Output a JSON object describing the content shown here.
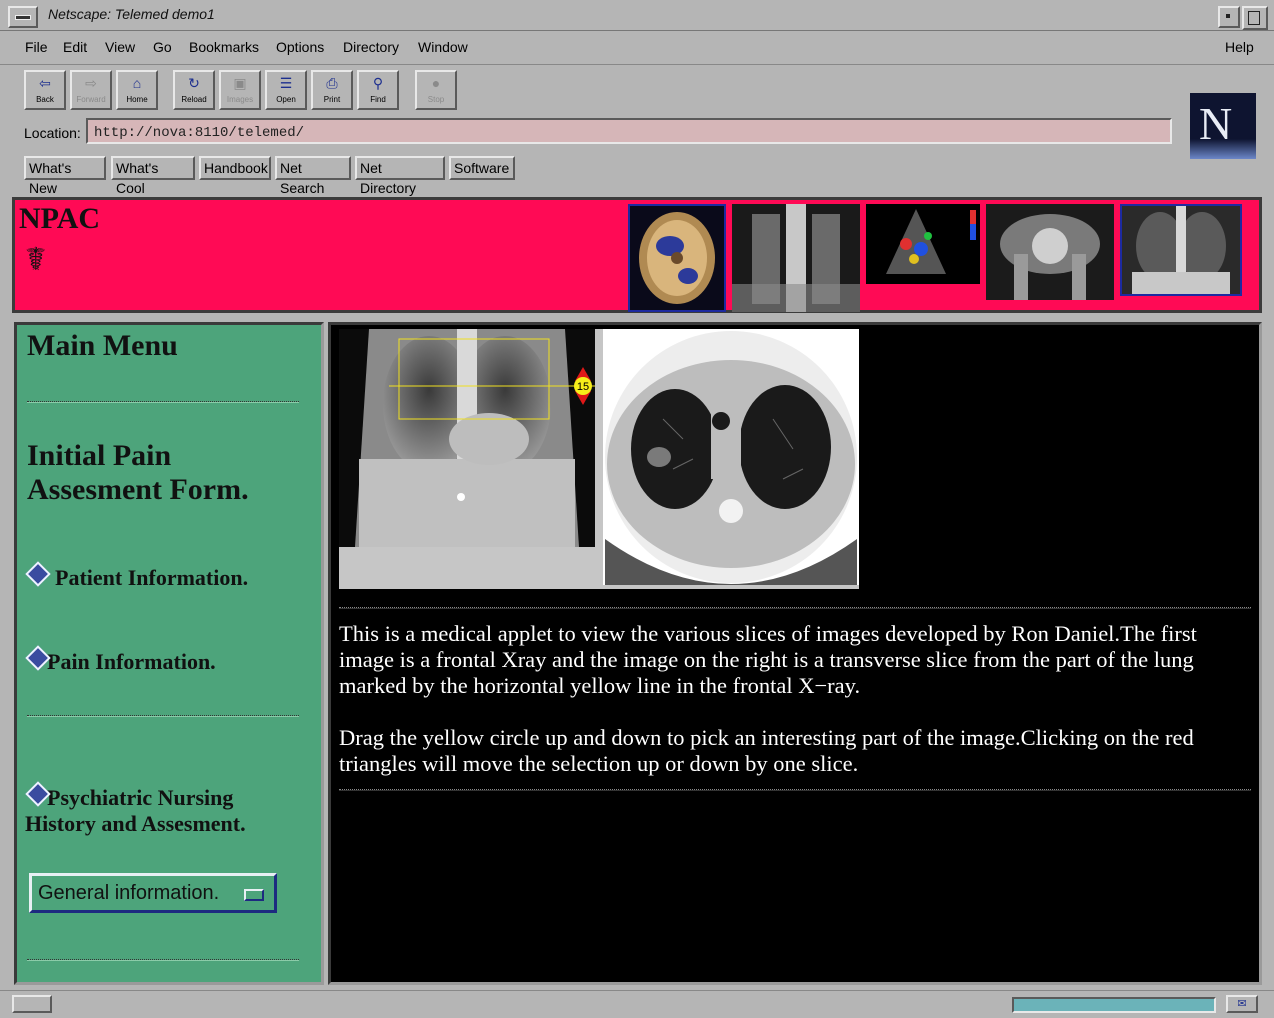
{
  "window": {
    "title": "Netscape: Telemed demo1"
  },
  "menu": {
    "file": "File",
    "edit": "Edit",
    "view": "View",
    "go": "Go",
    "bookmarks": "Bookmarks",
    "options": "Options",
    "directory": "Directory",
    "window": "Window",
    "help": "Help"
  },
  "toolbar": {
    "back": "Back",
    "forward": "Forward",
    "home": "Home",
    "reload": "Reload",
    "images": "Images",
    "open": "Open",
    "print": "Print",
    "find": "Find",
    "stop": "Stop"
  },
  "location": {
    "label": "Location:",
    "url": "http://nova:8110/telemed/"
  },
  "directory_buttons": {
    "whats_new": "What's New",
    "whats_cool": "What's Cool",
    "handbook": "Handbook",
    "net_search": "Net Search",
    "net_directory": "Net Directory",
    "software": "Software"
  },
  "logo": {
    "letter": "N"
  },
  "banner": {
    "title": "NPAC",
    "emblem": "☤"
  },
  "left_menu": {
    "heading": "Main Menu",
    "form_title_line1": "Initial Pain",
    "form_title_line2": "Assesment Form.",
    "patient_info": "Patient Information.",
    "pain_info": "Pain Information.",
    "psych_line1": "Psychiatric Nursing",
    "psych_line2": "History and Assesment.",
    "select_value": "General information."
  },
  "applet": {
    "slice_number": "15"
  },
  "content": {
    "paragraph1": "This is a medical applet to view the various slices of images developed by Ron Daniel.The first image is a frontal Xray and the image on the right is a transverse slice from the part of the lung marked by the horizontal yellow line in the frontal X−ray.",
    "paragraph2": "Drag the yellow circle up and down to pick an interesting part of the image.Clicking on the red triangles will move the selection up or down by one slice."
  },
  "colors": {
    "banner_bg": "#ff0a55",
    "left_frame_bg": "#4da47b",
    "content_bg": "#000000",
    "location_bg": "#d6b6b8",
    "chrome_bg": "#b5b5b5"
  },
  "icons": {
    "back": "back-arrow-icon",
    "forward": "forward-arrow-icon",
    "home": "home-icon",
    "reload": "reload-icon",
    "images": "images-icon",
    "open": "open-icon",
    "print": "print-icon",
    "find": "binoculars-icon",
    "stop": "stop-icon"
  }
}
